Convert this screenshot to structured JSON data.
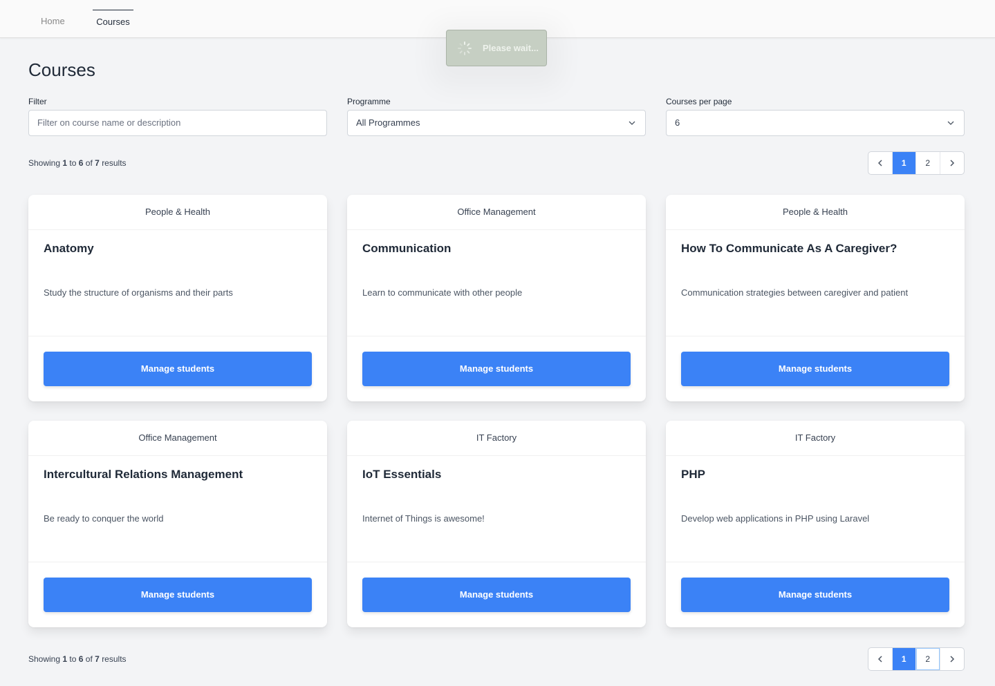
{
  "nav": {
    "items": [
      {
        "label": "Home",
        "active": false
      },
      {
        "label": "Courses",
        "active": true
      }
    ]
  },
  "loader": {
    "text": "Please wait...",
    "icon": "spinner-icon"
  },
  "page": {
    "title": "Courses"
  },
  "filters": {
    "filter": {
      "label": "Filter",
      "placeholder": "Filter on course name or description",
      "value": ""
    },
    "programme": {
      "label": "Programme",
      "selected": "All Programmes"
    },
    "per_page": {
      "label": "Courses per page",
      "selected": "6"
    }
  },
  "results": {
    "prefix": "Showing",
    "from": "1",
    "to_word": "to",
    "to": "6",
    "of_word": "of",
    "total": "7",
    "suffix": "results"
  },
  "pagination": {
    "prev_icon": "chevron-left-icon",
    "pages": [
      "1",
      "2"
    ],
    "current": "1",
    "next_icon": "chevron-right-icon"
  },
  "courses": [
    {
      "programme": "People & Health",
      "name": "Anatomy",
      "description": "Study the structure of organisms and their parts",
      "button": "Manage students"
    },
    {
      "programme": "Office Management",
      "name": "Communication",
      "description": "Learn to communicate with other people",
      "button": "Manage students"
    },
    {
      "programme": "People & Health",
      "name": "How To Communicate As A Caregiver?",
      "description": "Communication strategies between caregiver and patient",
      "button": "Manage students"
    },
    {
      "programme": "Office Management",
      "name": "Intercultural Relations Management",
      "description": "Be ready to conquer the world",
      "button": "Manage students"
    },
    {
      "programme": "IT Factory",
      "name": "IoT Essentials",
      "description": "Internet of Things is awesome!",
      "button": "Manage students"
    },
    {
      "programme": "IT Factory",
      "name": "PHP",
      "description": "Develop web applications in PHP using Laravel",
      "button": "Manage students"
    }
  ],
  "colors": {
    "accent": "#3b82f6",
    "background": "#f3f4f6",
    "loader": "#c6cfc3"
  }
}
